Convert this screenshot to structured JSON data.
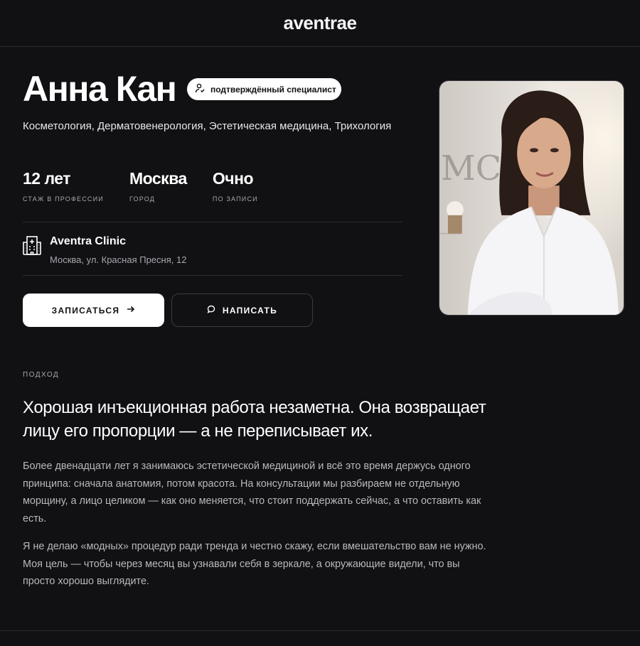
{
  "header": {
    "brand": "aventrae"
  },
  "profile": {
    "name": "Анна Кан",
    "badge": "подтверждённый специалист",
    "specialties": "Косметология, Дерматовенерология, Эстетическая медицина, Трихология",
    "stats": [
      {
        "value": "12 лет",
        "label": "стаж в профессии"
      },
      {
        "value": "Москва",
        "label": "город"
      },
      {
        "value": "Очно",
        "label": "по записи"
      }
    ],
    "clinic": {
      "name": "Aventra Clinic",
      "address": "Москва, ул. Красная Пресня, 12"
    },
    "actions": {
      "book": "ЗАПИСАТЬСЯ",
      "message": "НАПИСАТЬ"
    }
  },
  "approach": {
    "label": "подход",
    "headline": "Хорошая инъекционная работа незаметна. Она возвращает лицу его пропорции — а не переписывает их.",
    "paragraphs": [
      "Более двенадцати лет я занимаюсь эстетической медициной и всё это время держусь одного принципа: сначала анатомия, потом красота. На консультации мы разбираем не отдельную морщину, а лицо целиком — как оно меняется, что стоит поддержать сейчас, а что оставить как есть.",
      "Я не делаю «модных» процедур ради тренда и честно скажу, если вмешательство вам не нужно. Моя цель — чтобы через месяц вы узнавали себя в зеркале, а окружающие видели, что вы просто хорошо выглядите."
    ]
  },
  "icons": {
    "badge": "verified-person-icon",
    "clinic": "hospital-building-icon",
    "book": "arrow-right-icon",
    "message": "chat-bubble-icon"
  },
  "colors": {
    "background": "#111114",
    "text": "#ffffff",
    "muted": "#a6a6ad",
    "border": "#2c2c31"
  }
}
